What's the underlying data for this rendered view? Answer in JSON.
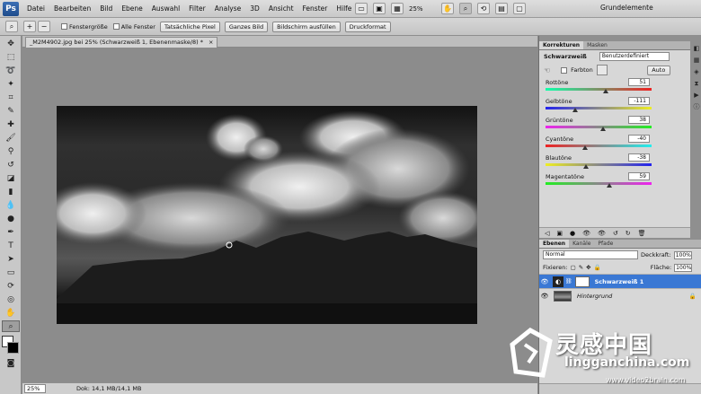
{
  "menubar": {
    "logo": "Ps",
    "items": [
      "Datei",
      "Bearbeiten",
      "Bild",
      "Ebene",
      "Auswahl",
      "Filter",
      "Analyse",
      "3D",
      "Ansicht",
      "Fenster",
      "Hilfe"
    ],
    "zoom": "25%",
    "workspace": "Grundelemente"
  },
  "options": {
    "fit_window": "Fenstergröße",
    "all_windows": "Alle Fenster",
    "btn_actual": "Tatsächliche Pixel",
    "btn_fit": "Ganzes Bild",
    "btn_fill": "Bildschirm ausfüllen",
    "btn_print": "Druckformat"
  },
  "document": {
    "tab_title": "_M2M4902.jpg bei 25% (Schwarzweiß 1, Ebenenmaske/8) *",
    "close": "×"
  },
  "status": {
    "zoom": "25%",
    "doc_size": "Dok: 14,1 MB/14,1 MB"
  },
  "adjustments": {
    "tabs": [
      "Korrekturen",
      "Masken"
    ],
    "title": "Schwarzweiß",
    "preset": "Benutzerdefiniert",
    "tint_label": "Farbton",
    "auto_label": "Auto",
    "sliders": [
      {
        "label": "Rottöne",
        "value": "51",
        "pos": 0.57
      },
      {
        "label": "Gelbtöne",
        "value": "-111",
        "pos": 0.28
      },
      {
        "label": "Grüntöne",
        "value": "38",
        "pos": 0.54
      },
      {
        "label": "Cyantöne",
        "value": "-40",
        "pos": 0.37
      },
      {
        "label": "Blautöne",
        "value": "-38",
        "pos": 0.38
      },
      {
        "label": "Magentatöne",
        "value": "59",
        "pos": 0.6
      }
    ]
  },
  "layers": {
    "tabs": [
      "Ebenen",
      "Kanäle",
      "Pfade"
    ],
    "blend_mode": "Normal",
    "opacity_label": "Deckkraft:",
    "opacity": "100%",
    "lock_label": "Fixieren:",
    "fill_label": "Fläche:",
    "fill": "100%",
    "items": [
      {
        "name": "Schwarzweiß 1",
        "selected": true
      },
      {
        "name": "Hintergrund",
        "selected": false
      }
    ]
  },
  "watermark": {
    "brand": "灵感中国",
    "site": "lingganchina.com",
    "url": "www.video2brain.com"
  }
}
